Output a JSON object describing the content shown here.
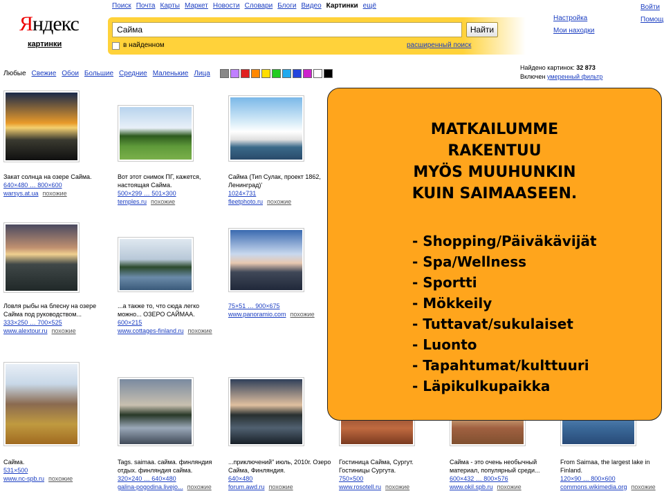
{
  "header": {
    "logo_text": "Яндекс",
    "logo_sub": "картинки",
    "nav": [
      "Поиск",
      "Почта",
      "Карты",
      "Маркет",
      "Новости",
      "Словари",
      "Блоги",
      "Видео",
      "Картинки",
      "ещё"
    ],
    "active_nav": "Картинки",
    "search_value": "Сайма",
    "search_button": "Найти",
    "in_found_label": "в найденном",
    "advanced_search": "расширенный поиск",
    "settings": "Настройка",
    "my_finds": "Мои находки",
    "login": "Войти",
    "help": "Помощь"
  },
  "filters": {
    "items": [
      "Любые",
      "Свежие",
      "Обои",
      "Большие",
      "Средние",
      "Маленькие",
      "Лица"
    ],
    "swatch_colors": [
      "#888888",
      "#c080ff",
      "#e02020",
      "#ff8800",
      "#ffdd00",
      "#22cc22",
      "#22aaee",
      "#2244dd",
      "#cc22cc",
      "#ffffff",
      "#000000"
    ],
    "found_label": "Найдено картинок:",
    "found_count": "32 873",
    "filter_on": "Включен",
    "filter_name": "умеренный фильтр"
  },
  "results": [
    {
      "t1": "Закат солнца на озере Сайма.",
      "t2": "",
      "t3": "",
      "size": "640×480 … 800×600",
      "src": "warsys.at.ua",
      "sim": "похожие"
    },
    {
      "t1": "Вот этот снимок ПГ, кажется,",
      "t2": "настоящая Сайма.",
      "t3": "",
      "size": "500×299 … 501×300",
      "src": "temples.ru",
      "sim": "похожие"
    },
    {
      "t1": "Сайма (Тип Сулак, проект 1862,",
      "t2": "Ленинград)'",
      "t3": "",
      "size": "1024×731",
      "src": "fleetphoto.ru",
      "sim": "похожие"
    },
    {
      "t1": "Ловля рыбы на блесну на озере",
      "t2": "Сайма под руководством...",
      "t3": "",
      "size": "333×250 … 700×525",
      "src": "www.alextour.ru",
      "sim": "похожие"
    },
    {
      "t1": "...а также то, что сюда легко",
      "t2": "можно... ОЗЕРО САЙМАА.",
      "t3": "",
      "size": "600×215",
      "src": "www.cottages-finland.ru",
      "sim": "похожие"
    },
    {
      "t1": "",
      "t2": "",
      "t3": "",
      "size": "75×51 … 900×675",
      "src": "www.panoramio.com",
      "sim": "похожие"
    },
    {
      "t1": "Сайма.",
      "t2": "",
      "t3": "",
      "size": "531×500",
      "src": "www.nc-spb.ru",
      "sim": "похожие"
    },
    {
      "t1": "Tags. saimaa. сайма. финляндия",
      "t2": "отдых. финляндия сайма.",
      "t3": "",
      "size": "320×240 … 640×480",
      "src": "galina-pogodina.livejo...",
      "sim": "похожие"
    },
    {
      "t1": "...приключений\" июль, 2010г. Озеро",
      "t2": "Сайма, Финляндия.",
      "t3": "",
      "size": "640×480",
      "src": "forum.awd.ru",
      "sim": "похожие"
    },
    {
      "t1": "Гостиница Сайма, Сургут.",
      "t2": "Гостиницы Сургута.",
      "t3": "",
      "size": "750×500",
      "src": "www.rosotell.ru",
      "sim": "похожие"
    },
    {
      "t1": "Сайма - это очень необычный",
      "t2": "материал, популярный среди...",
      "t3": "",
      "size": "600×432 … 800×576",
      "src": "www.okil.spb.ru",
      "sim": "похожие"
    },
    {
      "t1": "From Saimaa, the largest lake in",
      "t2": "Finland.",
      "t3": "",
      "size": "120×90 … 800×600",
      "src": "commons.wikimedia.org",
      "sim": "похожие"
    }
  ],
  "overlay": {
    "title_lines": [
      "MATKAILUMME",
      "RAKENTUU",
      "MYÖS MUUHUNKIN",
      "KUIN SAIMAASEEN."
    ],
    "items": [
      "- Shopping/Päiväkävijät",
      "- Spa/Wellness",
      "- Sportti",
      "- Mökkeily",
      "- Tuttavat/sukulaiset",
      "- Luonto",
      "- Tapahtumat/kulttuuri",
      "- Läpikulkupaikka"
    ]
  }
}
